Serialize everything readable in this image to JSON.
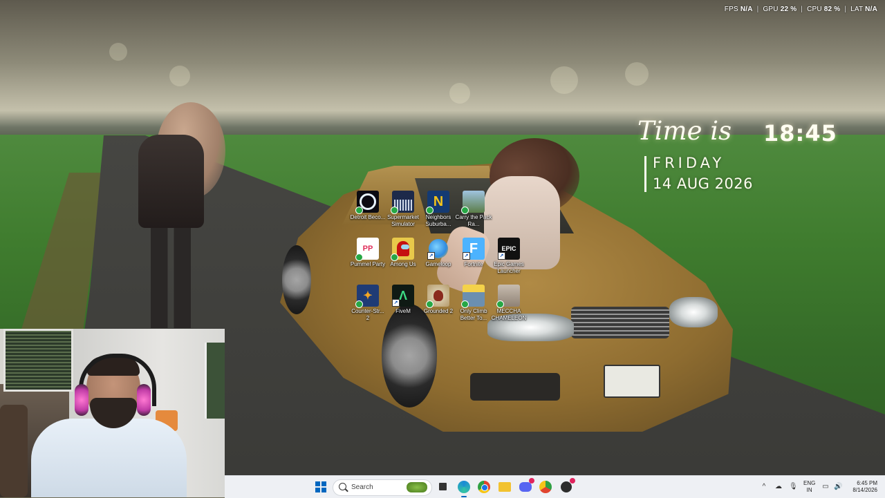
{
  "overlay": {
    "fps_label": "FPS",
    "fps_value": "N/A",
    "gpu_label": "GPU",
    "gpu_value": "22 %",
    "cpu_label": "CPU",
    "cpu_value": "82 %",
    "lat_label": "LAT",
    "lat_value": "N/A",
    "separator": "|"
  },
  "clock_widget": {
    "label": "Time is",
    "time": "18:45",
    "day": "FRIDAY",
    "date": "14 AUG 2026"
  },
  "desktop_icons": [
    {
      "label": "Detroit Beco...",
      "icon": "detroit-icon",
      "color": "#0b0b12"
    },
    {
      "label": "Supermarket Simulator",
      "icon": "supermarket-simulator-icon",
      "color": "#1d2a4a"
    },
    {
      "label": "Neighbors Suburba...",
      "icon": "neighbors-icon",
      "color": "#143a73"
    },
    {
      "label": "Carry the Pack Ra...",
      "icon": "carry-the-pack-icon",
      "color": "#6b8fb0"
    },
    {
      "label": "Pummel Party",
      "icon": "pummel-party-icon",
      "color": "#e02d5a"
    },
    {
      "label": "Among Us",
      "icon": "among-us-icon",
      "color": "#c51111"
    },
    {
      "label": "Gameloop",
      "icon": "gameloop-icon",
      "color": "#2f8be0"
    },
    {
      "label": "Fortnite",
      "icon": "fortnite-icon",
      "color": "#4cb3ff"
    },
    {
      "label": "Epic Games Launcher",
      "icon": "epic-games-icon",
      "color": "#111111"
    },
    {
      "label": "Counter-Str... 2",
      "icon": "counter-strike-icon",
      "color": "#1f3b75"
    },
    {
      "label": "FiveM",
      "icon": "fivem-icon",
      "color": "#0f1a14"
    },
    {
      "label": "Grounded 2",
      "icon": "grounded-icon",
      "color": "#8a2a1e"
    },
    {
      "label": "Only Climb Better To...",
      "icon": "only-climb-icon",
      "color": "#b99a3a"
    },
    {
      "label": "MECCHA CHAMELEON",
      "icon": "meccha-chameleon-icon",
      "color": "#a79a8b"
    }
  ],
  "taskbar": {
    "search_placeholder": "Search",
    "apps": [
      {
        "name": "file-explorer-icon",
        "color": "#3a3a3a"
      },
      {
        "name": "edge-icon",
        "color": "#1a8bd6"
      },
      {
        "name": "chrome-icon",
        "color": "#e0442f"
      },
      {
        "name": "folder-icon",
        "color": "#f2c230"
      },
      {
        "name": "discord-icon",
        "color": "#5865f2"
      },
      {
        "name": "chrome-profile-icon",
        "color": "#2ea043"
      },
      {
        "name": "app-icon",
        "color": "#2d2d2d"
      }
    ],
    "tray": {
      "lang_top": "ENG",
      "lang_bottom": "IN",
      "time": "6:45 PM",
      "date": "8/14/2026"
    }
  }
}
